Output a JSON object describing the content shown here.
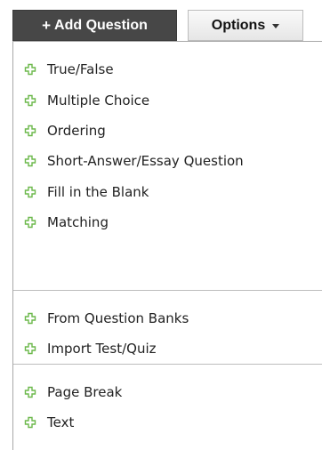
{
  "toolbar": {
    "add_question_label": "Add Question",
    "add_question_prefix": "+",
    "options_label": "Options"
  },
  "menu": {
    "groups": [
      {
        "items": [
          {
            "label": "True/False",
            "icon": "plus-icon"
          },
          {
            "label": "Multiple Choice",
            "icon": "plus-icon"
          },
          {
            "label": "Ordering",
            "icon": "plus-icon"
          },
          {
            "label": "Short-Answer/Essay Question",
            "icon": "plus-icon"
          },
          {
            "label": "Fill in the Blank",
            "icon": "plus-icon"
          },
          {
            "label": "Matching",
            "icon": "plus-icon"
          }
        ]
      },
      {
        "items": [
          {
            "label": "From Question Banks",
            "icon": "plus-icon"
          },
          {
            "label": "Import Test/Quiz",
            "icon": "plus-icon"
          }
        ]
      },
      {
        "items": [
          {
            "label": "Page Break",
            "icon": "plus-icon"
          },
          {
            "label": "Text",
            "icon": "plus-icon"
          }
        ]
      }
    ]
  },
  "colors": {
    "icon_green": "#6cb84b",
    "add_button_bg": "#474747"
  }
}
